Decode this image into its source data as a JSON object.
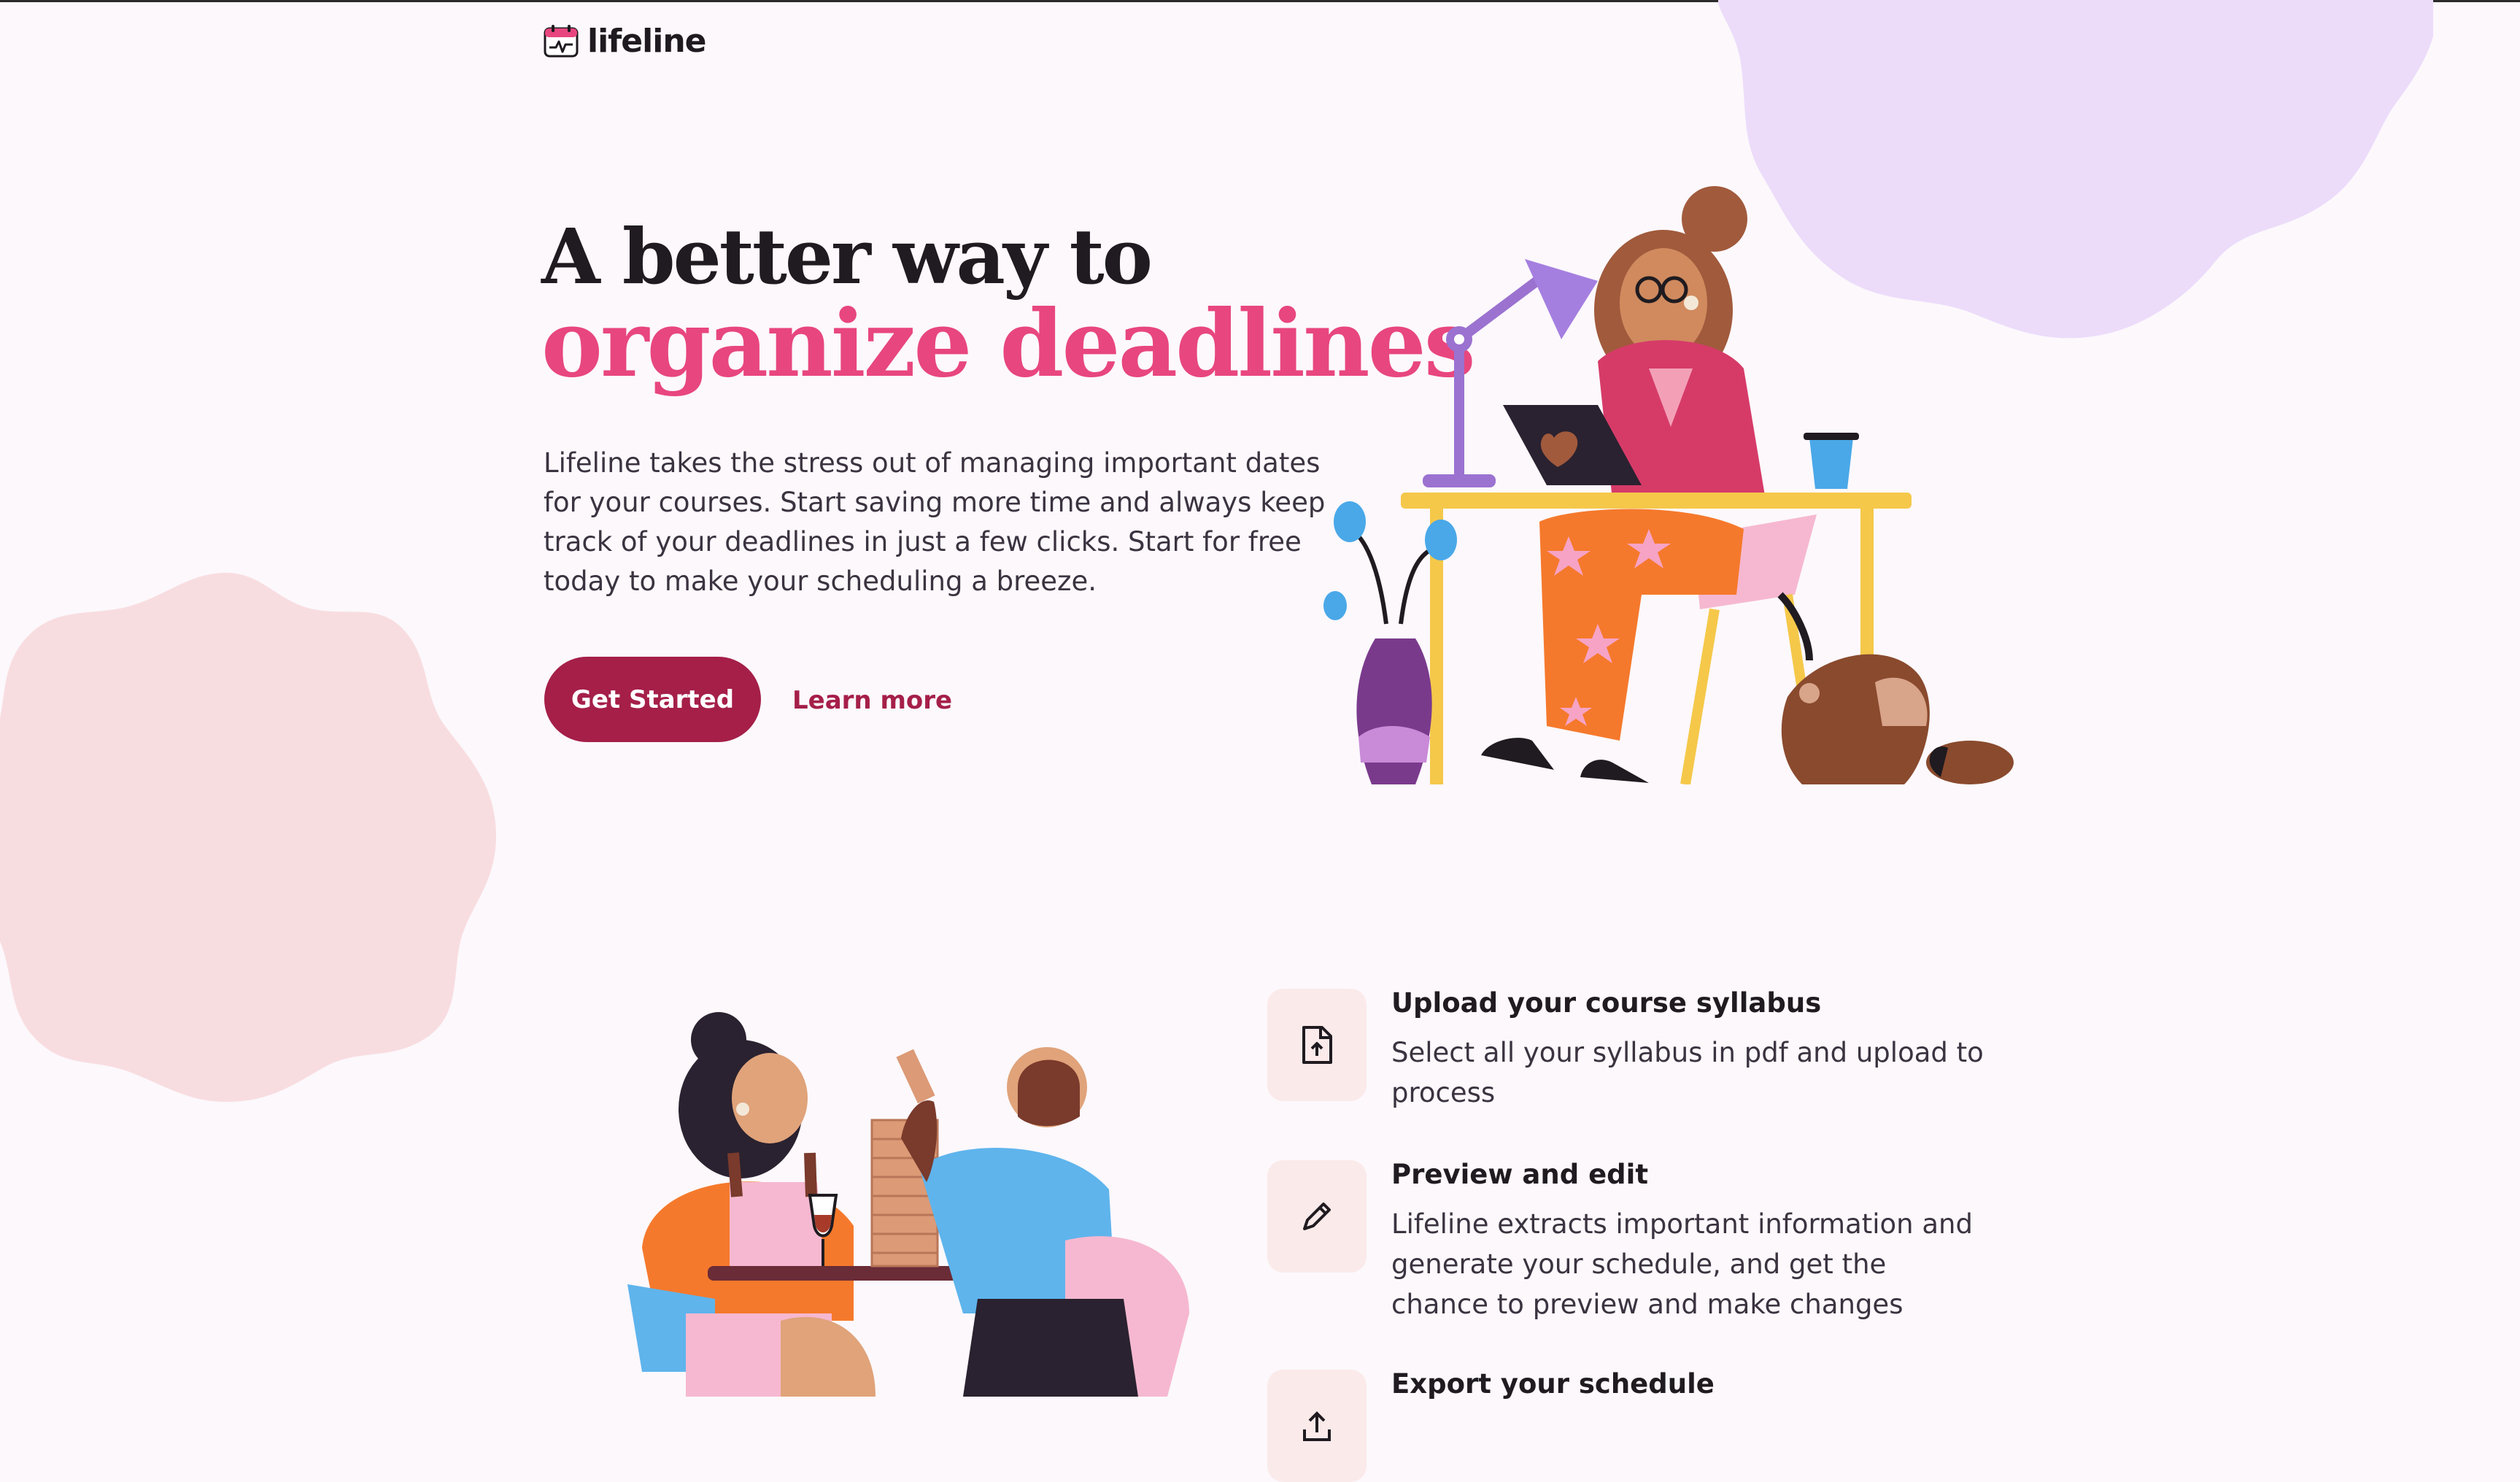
{
  "brand": {
    "name": "lifeline"
  },
  "hero": {
    "title_line1": "A better way to",
    "title_line2": "organize deadlines",
    "description": "Lifeline takes the stress out of managing important dates for your courses. Start saving more time and always keep track of your deadlines in just a few clicks. Start for free today to make your scheduling a breeze.",
    "primary_button": "Get Started",
    "secondary_link": "Learn more"
  },
  "features": [
    {
      "title": "Upload your course syllabus",
      "description": "Select all your syllabus in pdf and upload to process",
      "icon": "file-upload-icon"
    },
    {
      "title": "Preview and edit",
      "description": "Lifeline extracts important information and generate your schedule, and get the chance to preview and make changes",
      "icon": "pencil-icon"
    },
    {
      "title": "Export your schedule",
      "description": "",
      "icon": "export-icon"
    }
  ],
  "colors": {
    "accent": "#a51f49",
    "headline_pink": "#e8467e",
    "background": "#fcf8fc",
    "blob_purple": "#ecdcfa",
    "blob_pink": "#f8dde0",
    "feature_icon_bg": "#fbeaea"
  }
}
